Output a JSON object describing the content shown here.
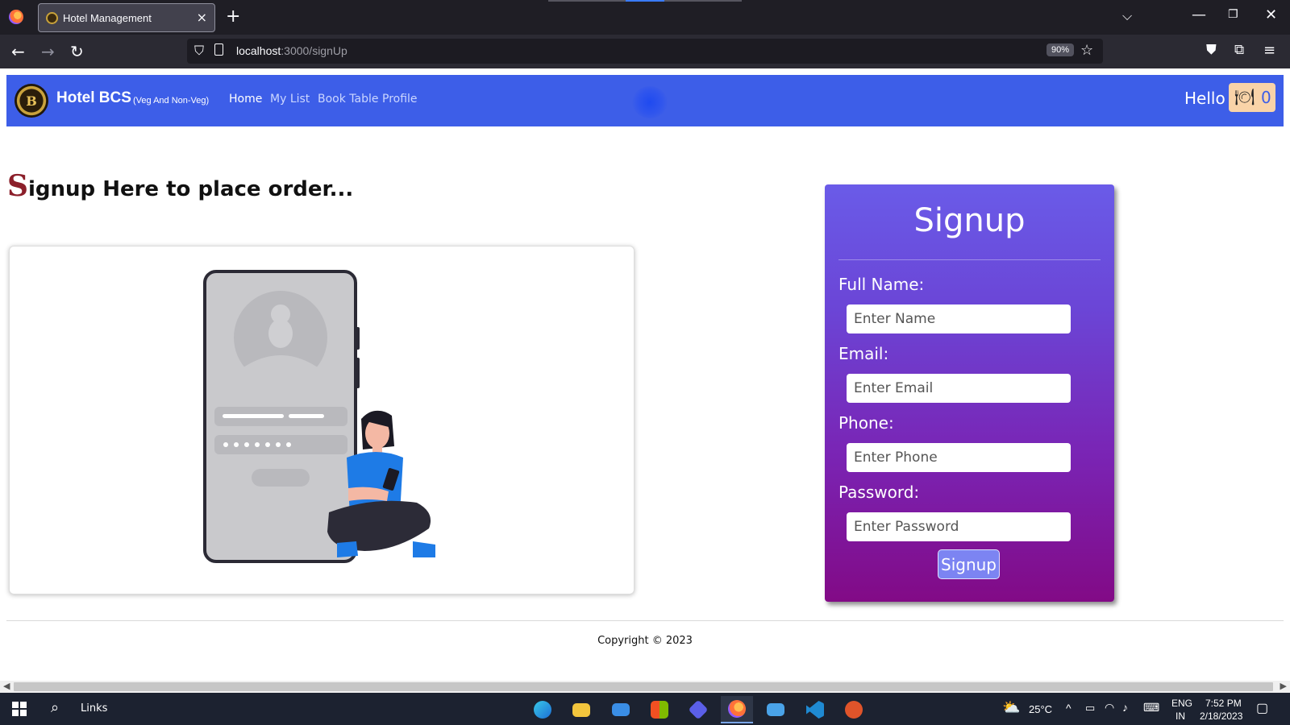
{
  "browser": {
    "tab_title": "Hotel Management",
    "tab_close": "×",
    "new_tab": "+",
    "url_host": "localhost",
    "url_path": ":3000/signUp",
    "zoom": "90%",
    "icons": [
      "firefox-icon",
      "back-icon",
      "forward-icon",
      "reload-icon",
      "shield-icon",
      "bookmark-star-icon",
      "pocket-icon",
      "extensions-icon",
      "menu-icon"
    ]
  },
  "site": {
    "logo_letter": "B",
    "brand": "Hotel BCS",
    "brand_sub": "(Veg And Non-Veg)",
    "nav": [
      "Home",
      "My List",
      "Book Table",
      "Profile"
    ],
    "greeting": "Hello",
    "cart_count": "0",
    "colors": {
      "navbar": "#3d5ee8",
      "heading_initial": "#8b1f2a",
      "card_top": "#6a5be8",
      "card_bottom": "#820a86"
    }
  },
  "page": {
    "heading_initial": "S",
    "heading_rest": "ignup Here to place order...",
    "copyright": "Copyright © 2023"
  },
  "signup": {
    "title": "Signup",
    "fields": [
      {
        "label": "Full Name:",
        "placeholder": "Enter Name"
      },
      {
        "label": "Email:",
        "placeholder": "Enter Email"
      },
      {
        "label": "Phone:",
        "placeholder": "Enter Phone"
      },
      {
        "label": "Password:",
        "placeholder": "Enter Password"
      }
    ],
    "button": "Signup"
  },
  "taskbar": {
    "search_label": "Links",
    "temperature": "25°C",
    "lang": "ENG",
    "region": "IN",
    "time": "7:52 PM",
    "date": "2/18/2023"
  }
}
